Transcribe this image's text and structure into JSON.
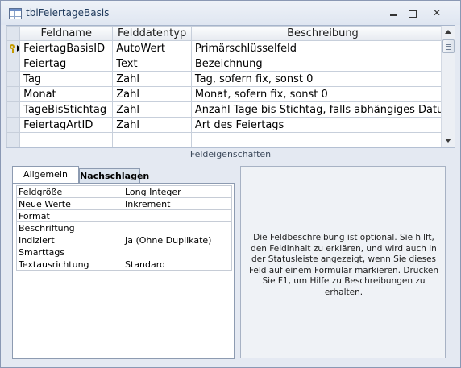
{
  "window": {
    "title": "tblFeiertageBasis"
  },
  "grid": {
    "columns": [
      "Feldname",
      "Felddatentyp",
      "Beschreibung"
    ],
    "rows": [
      {
        "name": "FeiertagBasisID",
        "type": "AutoWert",
        "description": "Primärschlüsselfeld",
        "primary_key": true
      },
      {
        "name": "Feiertag",
        "type": "Text",
        "description": "Bezeichnung"
      },
      {
        "name": "Tag",
        "type": "Zahl",
        "description": "Tag, sofern fix, sonst 0"
      },
      {
        "name": "Monat",
        "type": "Zahl",
        "description": "Monat, sofern fix, sonst 0"
      },
      {
        "name": "TageBisStichtag",
        "type": "Zahl",
        "description": "Anzahl Tage bis Stichtag, falls abhängiges Datum"
      },
      {
        "name": "FeiertagArtID",
        "type": "Zahl",
        "description": "Art des Feiertags"
      },
      {
        "name": "",
        "type": "",
        "description": ""
      }
    ]
  },
  "field_properties": {
    "section_label": "Feldeigenschaften",
    "tabs": [
      "Allgemein",
      "Nachschlagen"
    ],
    "active_tab": "Allgemein",
    "properties": [
      {
        "label": "Feldgröße",
        "value": "Long Integer"
      },
      {
        "label": "Neue Werte",
        "value": "Inkrement"
      },
      {
        "label": "Format",
        "value": ""
      },
      {
        "label": "Beschriftung",
        "value": ""
      },
      {
        "label": "Indiziert",
        "value": "Ja (Ohne Duplikate)"
      },
      {
        "label": "Smarttags",
        "value": ""
      },
      {
        "label": "Textausrichtung",
        "value": "Standard"
      }
    ],
    "help_text": "Die Feldbeschreibung ist optional. Sie hilft, den Feldinhalt zu erklären, und wird auch in der Statusleiste angezeigt, wenn Sie dieses Feld auf einem Formular markieren. Drücken Sie F1, um Hilfe zu Beschreibungen zu erhalten."
  },
  "icons": {
    "app": "table-icon",
    "primary_key": "key-icon",
    "current_row": "row-pointer-icon"
  }
}
